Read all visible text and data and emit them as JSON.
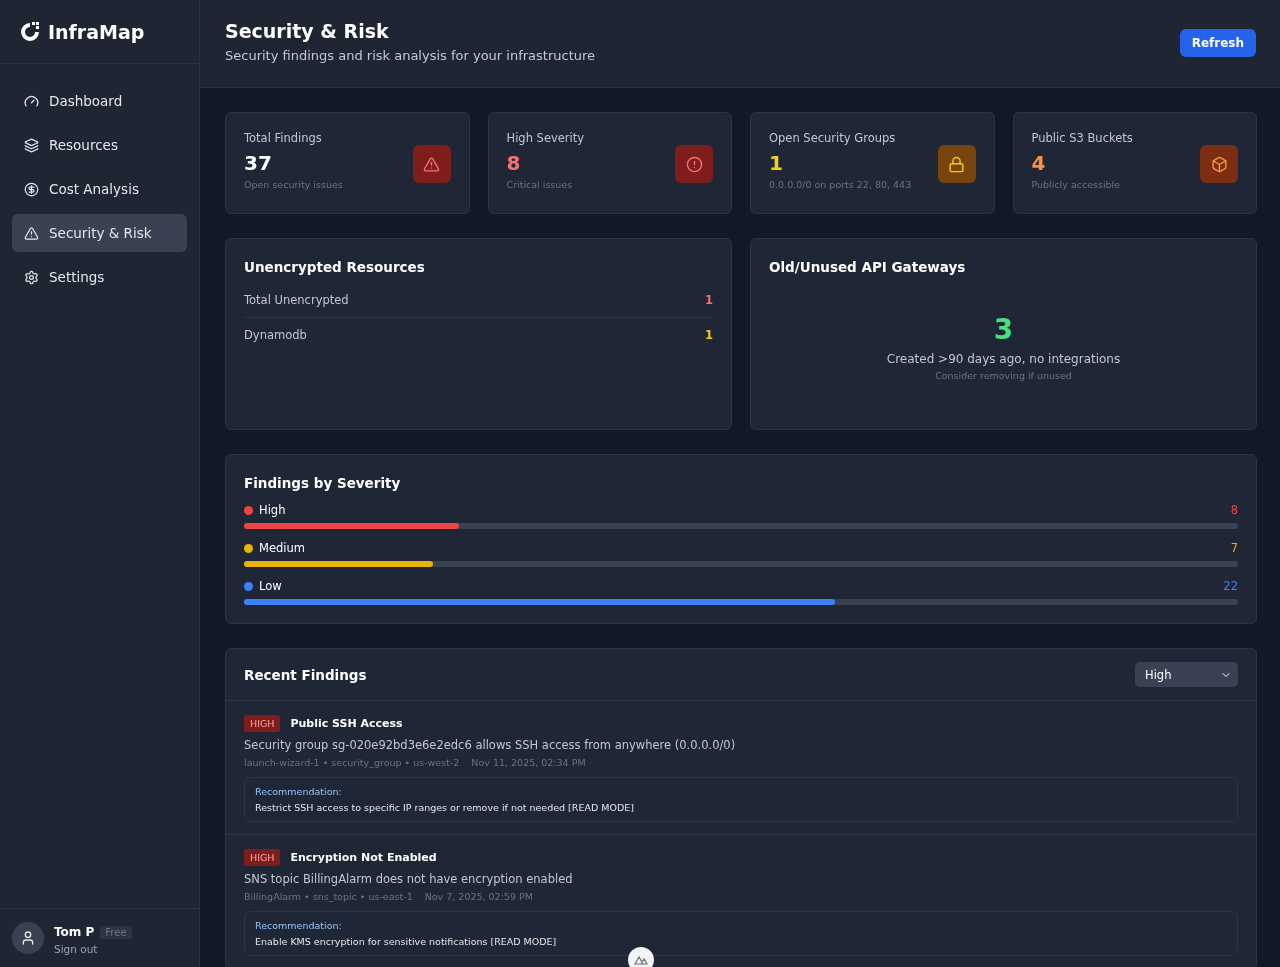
{
  "brand": {
    "name": "InfraMap"
  },
  "sidebar": {
    "items": [
      {
        "label": "Dashboard",
        "selected": false
      },
      {
        "label": "Resources",
        "selected": false
      },
      {
        "label": "Cost Analysis",
        "selected": false
      },
      {
        "label": "Security & Risk",
        "selected": true
      },
      {
        "label": "Settings",
        "selected": false
      }
    ]
  },
  "user": {
    "name": "Tom P",
    "plan": "Free",
    "sign_out": "Sign out"
  },
  "header": {
    "title": "Security & Risk",
    "subtitle": "Security findings and risk analysis for your infrastructure",
    "button": "Refresh"
  },
  "stats": [
    {
      "label": "Total Findings",
      "value": "37",
      "note": "Open security issues",
      "color": "#ffffff"
    },
    {
      "label": "High Severity",
      "value": "8",
      "note": "Critical issues",
      "color": "#f87171"
    },
    {
      "label": "Open Security Groups",
      "value": "1",
      "note": "0.0.0.0/0 on ports 22, 80, 443",
      "color": "#facc15"
    },
    {
      "label": "Public S3 Buckets",
      "value": "4",
      "note": "Publicly accessible",
      "color": "#fb923c"
    }
  ],
  "unencrypted": {
    "title": "Unencrypted Resources",
    "rows": [
      {
        "label": "Total Unencrypted",
        "value": "1",
        "color": "#f87171"
      },
      {
        "label": "Dynamodb",
        "value": "1",
        "color": "#facc15"
      }
    ]
  },
  "api_gateways": {
    "title": "Old/Unused API Gateways",
    "value": "3",
    "description": "Created >90 days ago, no integrations",
    "hint": "Consider removing if unused"
  },
  "severity": {
    "title": "Findings by Severity",
    "rows": [
      {
        "label": "High",
        "count": "8",
        "level": 0.216,
        "color": "#ef4444"
      },
      {
        "label": "Medium",
        "count": "7",
        "level": 0.19,
        "color": "#eab308"
      },
      {
        "label": "Low",
        "count": "22",
        "level": 0.595,
        "color": "#3b82f6"
      }
    ]
  },
  "recent": {
    "title": "Recent Findings",
    "filter": "High",
    "findings": [
      {
        "severity": "HIGH",
        "title": "Public SSH Access",
        "description": "Security group sg-020e92bd3e6e2edc6 allows SSH access from anywhere (0.0.0.0/0)",
        "meta": "launch-wizard-1 • security_group • us-west-2",
        "time": "Nov 11, 2025, 02:34 PM",
        "rec_label": "Recommendation:",
        "recommendation": "Restrict SSH access to specific IP ranges or remove if not needed [READ MODE]"
      },
      {
        "severity": "HIGH",
        "title": "Encryption Not Enabled",
        "description": "SNS topic BillingAlarm does not have encryption enabled",
        "meta": "BillingAlarm • sns_topic • us-east-1",
        "time": "Nov 7, 2025, 02:59 PM",
        "rec_label": "Recommendation:",
        "recommendation": "Enable KMS encryption for sensitive notifications [READ MODE]"
      }
    ]
  }
}
